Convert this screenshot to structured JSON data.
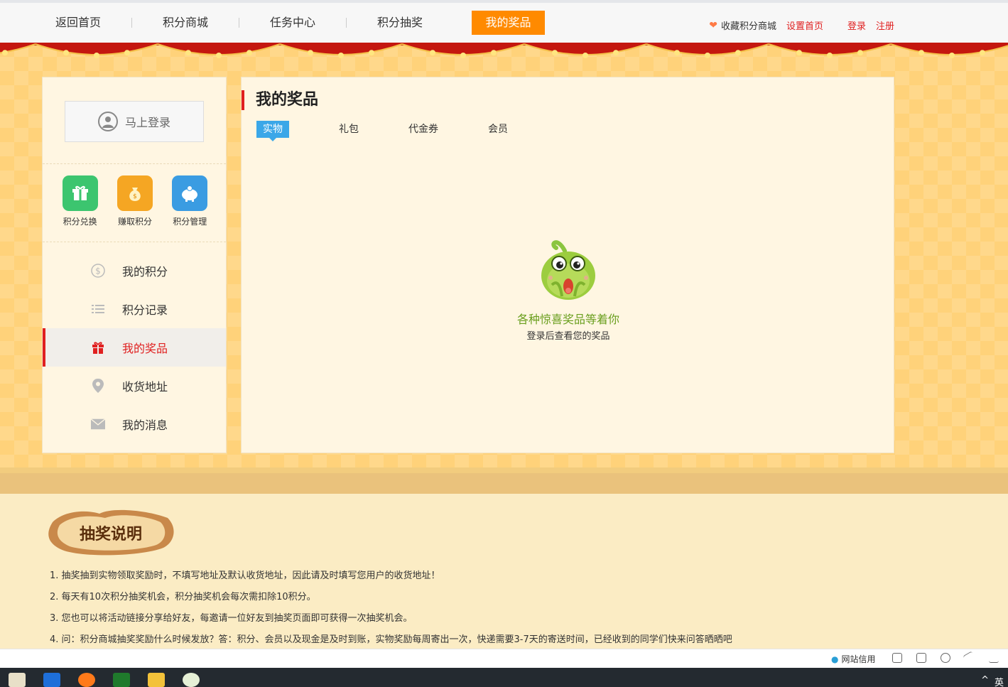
{
  "nav": {
    "items": [
      "返回首页",
      "积分商城",
      "任务中心",
      "积分抽奖",
      "我的奖品"
    ],
    "active_index": 4,
    "favorite_label": "收藏积分商城",
    "set_home_label": "设置首页",
    "login_label": "登录",
    "register_label": "注册"
  },
  "sidebar": {
    "login_button": "马上登录",
    "quick_links": [
      {
        "label": "积分兑换",
        "icon": "gift-icon",
        "color": "#3cc56f"
      },
      {
        "label": "赚取积分",
        "icon": "money-bag-icon",
        "color": "#f5a623"
      },
      {
        "label": "积分管理",
        "icon": "piggy-bank-icon",
        "color": "#3a9ce2"
      }
    ],
    "menu": [
      {
        "label": "我的积分",
        "icon": "coin-icon"
      },
      {
        "label": "积分记录",
        "icon": "list-icon"
      },
      {
        "label": "我的奖品",
        "icon": "gift-icon",
        "active": true
      },
      {
        "label": "收货地址",
        "icon": "location-pin-icon"
      },
      {
        "label": "我的消息",
        "icon": "envelope-icon"
      }
    ]
  },
  "main": {
    "title": "我的奖品",
    "tabs": [
      "实物",
      "礼包",
      "代金券",
      "会员"
    ],
    "active_tab": 0,
    "empty_title": "各种惊喜奖品等着你",
    "empty_subtitle": "登录后查看您的奖品"
  },
  "rules": {
    "badge": "抽奖说明",
    "items": [
      "1. 抽奖抽到实物领取奖励时，不填写地址及默认收货地址，因此请及时填写您用户的收货地址！",
      "2. 每天有10次积分抽奖机会，积分抽奖机会每次需扣除10积分。",
      "3. 您也可以将活动链接分享给好友，每邀请一位好友到抽奖页面即可获得一次抽奖机会。",
      "4. 问：积分商城抽奖奖励什么时候发放？答：积分、会员以及现金是及时到账，实物奖励每周寄出一次，快递需要3-7天的寄送时间，已经收到的同学们快来问答晒晒吧"
    ]
  },
  "statusbar": {
    "credit_label": "网站信用"
  },
  "taskbar": {
    "tray_text": "英"
  },
  "colors": {
    "accent_orange": "#ff8a00",
    "accent_red": "#e02020",
    "tab_blue": "#3ba7e8",
    "empty_green": "#6a9f1e",
    "page_bg": "#ffd27a"
  }
}
